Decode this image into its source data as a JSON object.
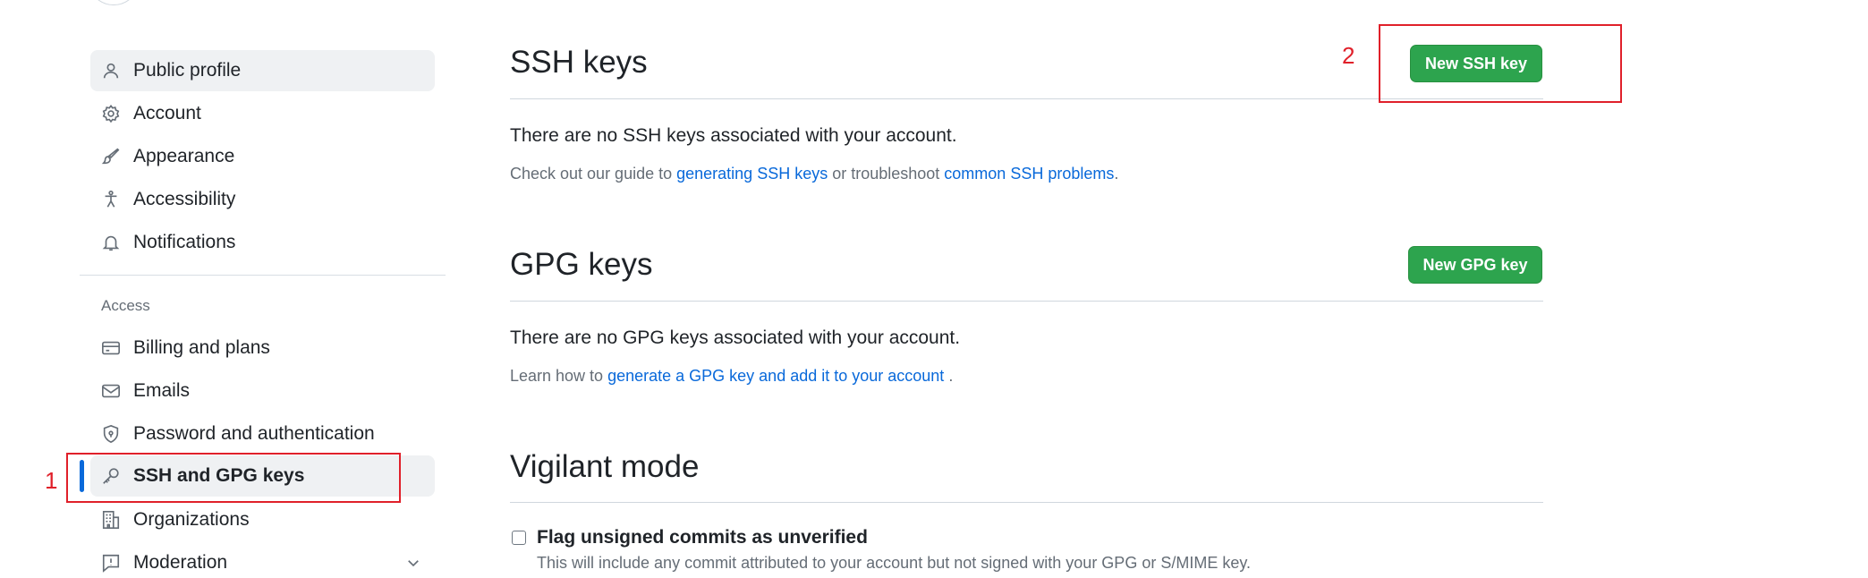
{
  "sidebar": {
    "items_top": [
      {
        "label": "Public profile",
        "icon": "person-icon"
      },
      {
        "label": "Account",
        "icon": "gear-icon"
      },
      {
        "label": "Appearance",
        "icon": "paintbrush-icon"
      },
      {
        "label": "Accessibility",
        "icon": "accessibility-icon"
      },
      {
        "label": "Notifications",
        "icon": "bell-icon"
      }
    ],
    "access_heading": "Access",
    "items_access": [
      {
        "label": "Billing and plans",
        "icon": "credit-card-icon"
      },
      {
        "label": "Emails",
        "icon": "mail-icon"
      },
      {
        "label": "Password and authentication",
        "icon": "shield-lock-icon"
      },
      {
        "label": "SSH and GPG keys",
        "icon": "key-icon"
      },
      {
        "label": "Organizations",
        "icon": "organization-icon"
      },
      {
        "label": "Moderation",
        "icon": "report-icon"
      }
    ]
  },
  "ssh": {
    "title": "SSH keys",
    "button": "New SSH key",
    "empty": "There are no SSH keys associated with your account.",
    "note_prefix": "Check out our guide to ",
    "note_link1": "generating SSH keys",
    "note_mid": " or troubleshoot ",
    "note_link2": "common SSH problems",
    "note_suffix": "."
  },
  "gpg": {
    "title": "GPG keys",
    "button": "New GPG key",
    "empty": "There are no GPG keys associated with your account.",
    "note_prefix": "Learn how to ",
    "note_link": "generate a GPG key and add it to your account",
    "note_suffix": " ."
  },
  "vigilant": {
    "title": "Vigilant mode",
    "checkbox_label": "Flag unsigned commits as unverified",
    "checkbox_note": "This will include any commit attributed to your account but not signed with your GPG or S/MIME key."
  },
  "annotations": {
    "one": "1",
    "two": "2"
  },
  "colors": {
    "accent": "#0969da",
    "button_green": "#2da44e",
    "annotation_red": "#e0202a"
  }
}
